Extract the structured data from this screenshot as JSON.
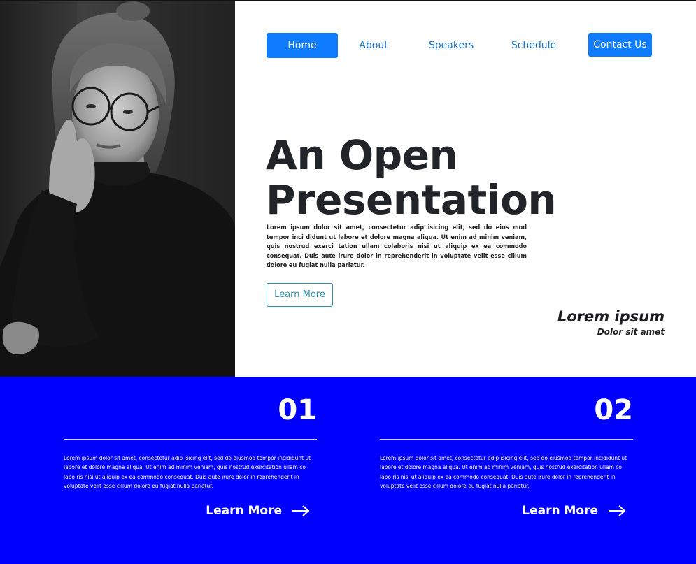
{
  "nav": {
    "items": [
      {
        "label": "Home"
      },
      {
        "label": "About"
      },
      {
        "label": "Speakers"
      },
      {
        "label": "Schedule"
      }
    ],
    "contact_label": "Contact Us"
  },
  "hero": {
    "photo_icon": "portrait-photo",
    "title_line1": "An Open",
    "title_line2": "Presentation",
    "body": "Lorem ipsum dolor sit amet, consectetur adip isicing elit, sed do eius mod tempor inci didunt ut labore et dolore magna aliqua. Ut enim ad minim veniam, quis nostrud exerci tation ullam colaboris nisi ut aliquip ex ea commodo consequat. Duis aute irure dolor in reprehenderit in voluptate velit esse cillum dolore eu fugiat nulla pariatur.",
    "button_label": "Learn More",
    "tag_title": "Lorem ipsum",
    "tag_subtitle": "Dolor sit amet"
  },
  "features": [
    {
      "number": "01",
      "text": "Lorem ipsum dolor sit amet, consectetur adip isicing elit, sed do eiusmod tempor incididunt ut labore et dolore magna aliqua. Ut enim ad minim veniam, quis nostrud exercitation ullam co labo ris nisi ut aliquip ex ea commodo consequat. Duis aute irure dolor in reprehenderit in voluptate velit esse cillum dolore eu fugiat nulla pariatur.",
      "link_label": "Learn More",
      "link_icon": "arrow-right-icon"
    },
    {
      "number": "02",
      "text": "Lorem ipsum dolor sit amet, consectetur adip isicing elit, sed do eiusmod tempor incididunt ut labore et dolore magna aliqua. Ut enim ad minim veniam, quis nostrud exercitation ullam co labo ris nisi ut aliquip ex ea commodo consequat. Duis aute irure dolor in reprehenderit in voluptate velit esse cillum dolore eu fugiat nulla pariatur.",
      "link_label": "Learn More",
      "link_icon": "arrow-right-icon"
    }
  ],
  "colors": {
    "accent": "#0f7cff",
    "band": "#0000ff",
    "outline_button": "#2a8fa6",
    "heading": "#212429"
  }
}
